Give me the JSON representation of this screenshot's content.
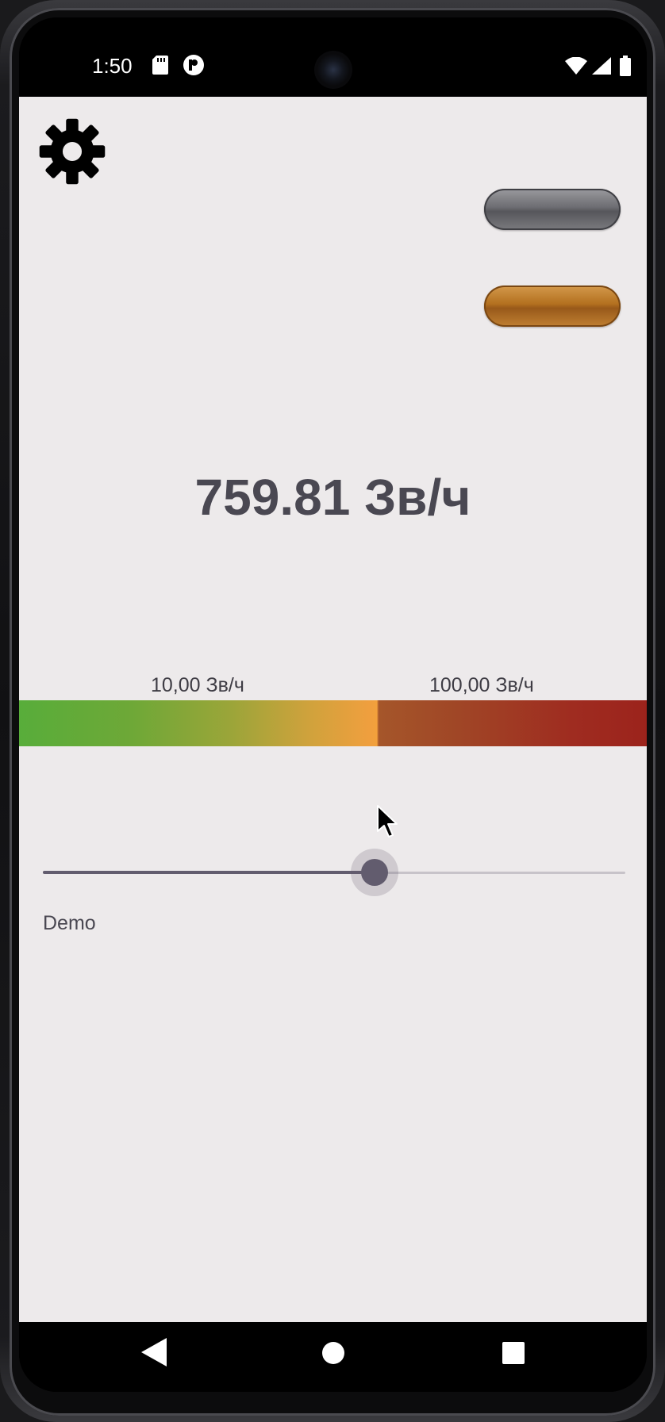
{
  "status_bar": {
    "time": "1:50",
    "icons": [
      "sd-card-icon",
      "p-notification-icon",
      "wifi-icon",
      "signal-icon",
      "battery-icon"
    ]
  },
  "app": {
    "settings_icon": "gear-icon",
    "buttons": [
      {
        "name": "gray-pill-button",
        "color": "#6d6d72"
      },
      {
        "name": "orange-pill-button",
        "color": "#b3701f"
      }
    ],
    "reading": "759.81 Зв/ч",
    "scale": {
      "low_threshold_label": "10,00 Зв/ч",
      "high_threshold_label": "100,00 Зв/ч",
      "colors": {
        "low": "#58ad3a",
        "mid": "#f09f3e",
        "high": "#9c231c"
      }
    },
    "slider": {
      "value": 0.57,
      "label": "Demo",
      "accent": "#625c6e"
    }
  },
  "nav_bar": {
    "buttons": [
      "back-icon",
      "home-icon",
      "recents-icon"
    ]
  }
}
